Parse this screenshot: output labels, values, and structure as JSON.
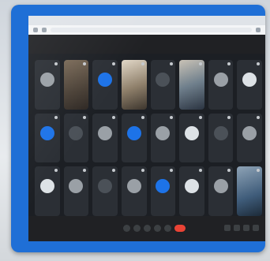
{
  "browser": {
    "tab_title": "",
    "url": ""
  },
  "meeting": {
    "info_text": "",
    "tiles": [
      {
        "name": "",
        "kind": "avatar",
        "color": "gray"
      },
      {
        "name": "",
        "kind": "video",
        "variant": "v1"
      },
      {
        "name": "",
        "kind": "avatar",
        "color": "blue"
      },
      {
        "name": "",
        "kind": "video",
        "variant": "v2"
      },
      {
        "name": "",
        "kind": "avatar",
        "color": "dark"
      },
      {
        "name": "",
        "kind": "video",
        "variant": "v3"
      },
      {
        "name": "",
        "kind": "avatar",
        "color": "gray"
      },
      {
        "name": "",
        "kind": "avatar",
        "color": "white"
      },
      {
        "name": "",
        "kind": "avatar",
        "color": "blue"
      },
      {
        "name": "",
        "kind": "avatar",
        "color": "dark"
      },
      {
        "name": "",
        "kind": "avatar",
        "color": "gray"
      },
      {
        "name": "",
        "kind": "avatar",
        "color": "blue"
      },
      {
        "name": "",
        "kind": "avatar",
        "color": "gray"
      },
      {
        "name": "",
        "kind": "avatar",
        "color": "white"
      },
      {
        "name": "",
        "kind": "avatar",
        "color": "dark"
      },
      {
        "name": "",
        "kind": "avatar",
        "color": "gray"
      },
      {
        "name": "",
        "kind": "avatar",
        "color": "white"
      },
      {
        "name": "",
        "kind": "avatar",
        "color": "gray"
      },
      {
        "name": "",
        "kind": "avatar",
        "color": "dark"
      },
      {
        "name": "",
        "kind": "avatar",
        "color": "gray"
      },
      {
        "name": "",
        "kind": "avatar",
        "color": "blue"
      },
      {
        "name": "",
        "kind": "avatar",
        "color": "white"
      },
      {
        "name": "",
        "kind": "avatar",
        "color": "gray"
      },
      {
        "name": "",
        "kind": "video",
        "variant": "v4"
      }
    ]
  },
  "controls": {
    "mic_icon": "mic-icon",
    "camera_icon": "camera-icon",
    "captions_icon": "captions-icon",
    "raise_hand_icon": "raise-hand-icon",
    "present_icon": "present-icon",
    "hangup_icon": "hangup-icon",
    "people_icon": "people-icon",
    "chat_icon": "chat-icon",
    "activities_icon": "activities-icon",
    "info_icon": "info-icon"
  },
  "colors": {
    "monitor_bezel": "#1f6fd6",
    "meet_background": "#202124",
    "tile_background": "#2b2f35",
    "hangup": "#ea4335",
    "avatar_blue": "#1d73e8"
  }
}
